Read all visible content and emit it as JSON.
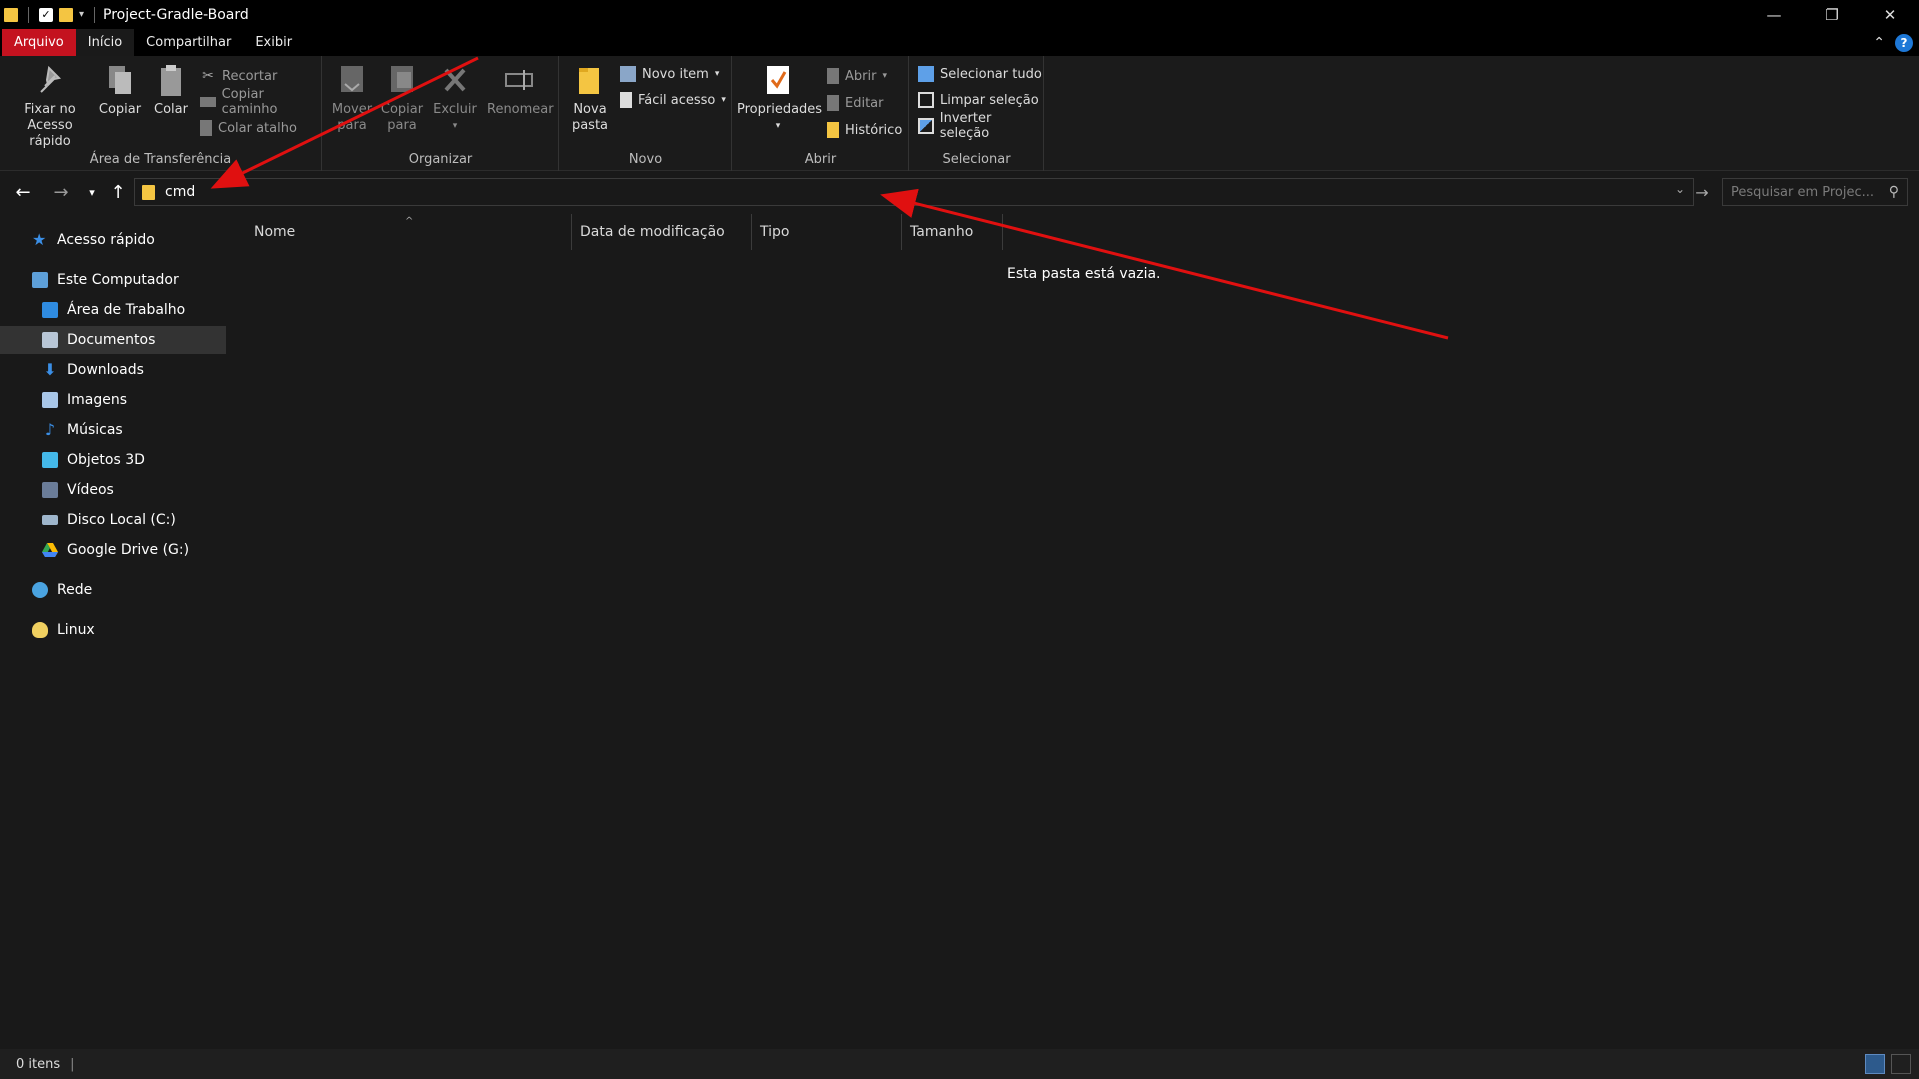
{
  "window": {
    "title": "Project-Gradle-Board",
    "controls": {
      "minimize": "—",
      "maximize": "❐",
      "close": "✕"
    }
  },
  "ribbon_tabs": [
    "Arquivo",
    "Início",
    "Compartilhar",
    "Exibir"
  ],
  "ribbon": {
    "clipboard": {
      "label": "Área de Transferência",
      "pin": "Fixar no Acesso rápido",
      "copy": "Copiar",
      "paste": "Colar",
      "cut": "Recortar",
      "copy_path": "Copiar caminho",
      "paste_shortcut": "Colar atalho"
    },
    "organize": {
      "label": "Organizar",
      "move_to": "Mover para",
      "copy_to": "Copiar para",
      "delete": "Excluir",
      "rename": "Renomear"
    },
    "new": {
      "label": "Novo",
      "new_folder": "Nova pasta",
      "new_item": "Novo item",
      "easy_access": "Fácil acesso"
    },
    "open": {
      "label": "Abrir",
      "properties": "Propriedades",
      "open": "Abrir",
      "edit": "Editar",
      "history": "Histórico"
    },
    "select": {
      "label": "Selecionar",
      "select_all": "Selecionar tudo",
      "select_none": "Limpar seleção",
      "invert": "Inverter seleção"
    }
  },
  "address": {
    "value": "cmd",
    "search_placeholder": "Pesquisar em Projec..."
  },
  "sidebar": {
    "items": [
      {
        "label": "Acesso rápido",
        "icon": "star-icon"
      },
      {
        "label": "Este Computador",
        "icon": "computer-icon"
      },
      {
        "label": "Área de Trabalho",
        "icon": "desktop-icon"
      },
      {
        "label": "Documentos",
        "icon": "documents-icon",
        "selected": true
      },
      {
        "label": "Downloads",
        "icon": "download-icon"
      },
      {
        "label": "Imagens",
        "icon": "images-icon"
      },
      {
        "label": "Músicas",
        "icon": "music-icon"
      },
      {
        "label": "Objetos 3D",
        "icon": "cube-icon"
      },
      {
        "label": "Vídeos",
        "icon": "video-icon"
      },
      {
        "label": "Disco Local (C:)",
        "icon": "drive-icon"
      },
      {
        "label": "Google Drive (G:)",
        "icon": "google-drive-icon"
      },
      {
        "label": "Rede",
        "icon": "network-icon"
      },
      {
        "label": "Linux",
        "icon": "linux-icon"
      }
    ]
  },
  "content": {
    "columns": [
      "Nome",
      "Data de modificação",
      "Tipo",
      "Tamanho"
    ],
    "empty_message": "Esta pasta está vazia."
  },
  "status": {
    "items": "0 itens"
  },
  "colors": {
    "accent_file_tab": "#c4121f",
    "annotation_arrow": "#e01010",
    "background": "#191919"
  }
}
